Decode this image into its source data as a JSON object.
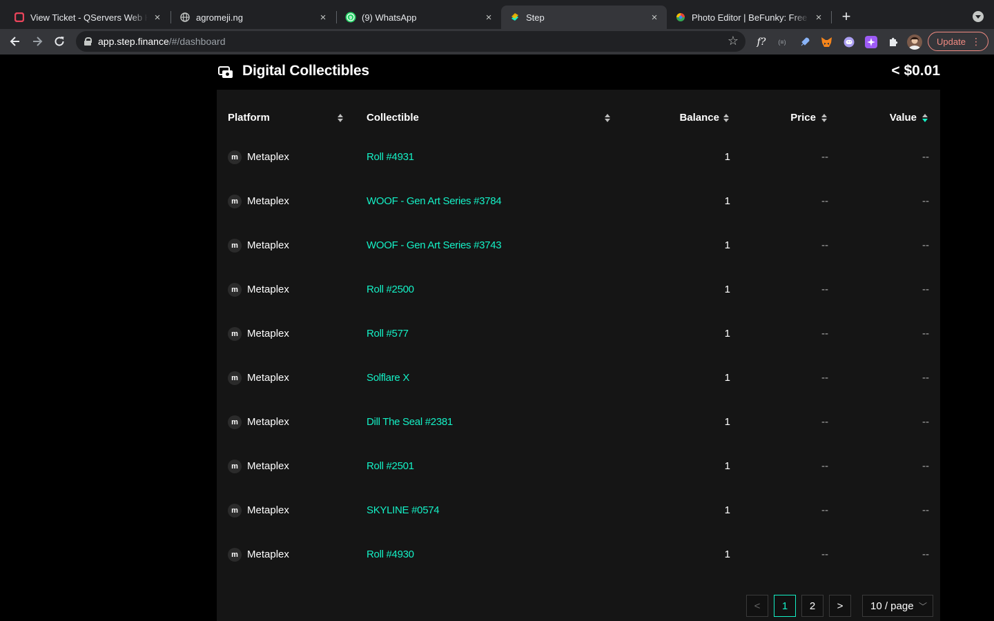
{
  "browser": {
    "tabs": [
      {
        "title": "View Ticket - QServers Web Hosting",
        "favicon": "qservers-icon"
      },
      {
        "title": "agromeji.ng",
        "favicon": "globe-icon"
      },
      {
        "title": "(9) WhatsApp",
        "favicon": "whatsapp-icon",
        "badge": "9"
      },
      {
        "title": "Step",
        "favicon": "step-icon",
        "active": true
      },
      {
        "title": "Photo Editor | BeFunky: Free Online",
        "favicon": "befunky-icon"
      }
    ],
    "close_glyph": "×",
    "url_host": "app.step.finance",
    "url_path": "/#/dashboard",
    "update_label": "Update",
    "extension_labels": [
      "f?",
      "(≡)"
    ]
  },
  "section": {
    "title": "Digital Collectibles",
    "total": "< $0.01"
  },
  "table": {
    "headers": {
      "platform": "Platform",
      "collectible": "Collectible",
      "balance": "Balance",
      "price": "Price",
      "value": "Value"
    },
    "platform_icon_glyph": "m",
    "rows": [
      {
        "platform": "Metaplex",
        "collectible": "Roll #4931",
        "balance": "1",
        "price": "--",
        "value": "--"
      },
      {
        "platform": "Metaplex",
        "collectible": "WOOF - Gen Art Series #3784",
        "balance": "1",
        "price": "--",
        "value": "--"
      },
      {
        "platform": "Metaplex",
        "collectible": "WOOF - Gen Art Series #3743",
        "balance": "1",
        "price": "--",
        "value": "--"
      },
      {
        "platform": "Metaplex",
        "collectible": "Roll #2500",
        "balance": "1",
        "price": "--",
        "value": "--"
      },
      {
        "platform": "Metaplex",
        "collectible": "Roll #577",
        "balance": "1",
        "price": "--",
        "value": "--"
      },
      {
        "platform": "Metaplex",
        "collectible": "Solflare X",
        "balance": "1",
        "price": "--",
        "value": "--"
      },
      {
        "platform": "Metaplex",
        "collectible": "Dill The Seal #2381",
        "balance": "1",
        "price": "--",
        "value": "--"
      },
      {
        "platform": "Metaplex",
        "collectible": "Roll #2501",
        "balance": "1",
        "price": "--",
        "value": "--"
      },
      {
        "platform": "Metaplex",
        "collectible": "SKYLINE #0574",
        "balance": "1",
        "price": "--",
        "value": "--"
      },
      {
        "platform": "Metaplex",
        "collectible": "Roll #4930",
        "balance": "1",
        "price": "--",
        "value": "--"
      }
    ]
  },
  "pagination": {
    "prev": "<",
    "pages": [
      "1",
      "2"
    ],
    "current": "1",
    "next": ">",
    "page_size": "10 / page"
  },
  "colors": {
    "accent": "#14f1c6",
    "panel": "#151515",
    "background": "#000000",
    "update": "#f28b82"
  }
}
